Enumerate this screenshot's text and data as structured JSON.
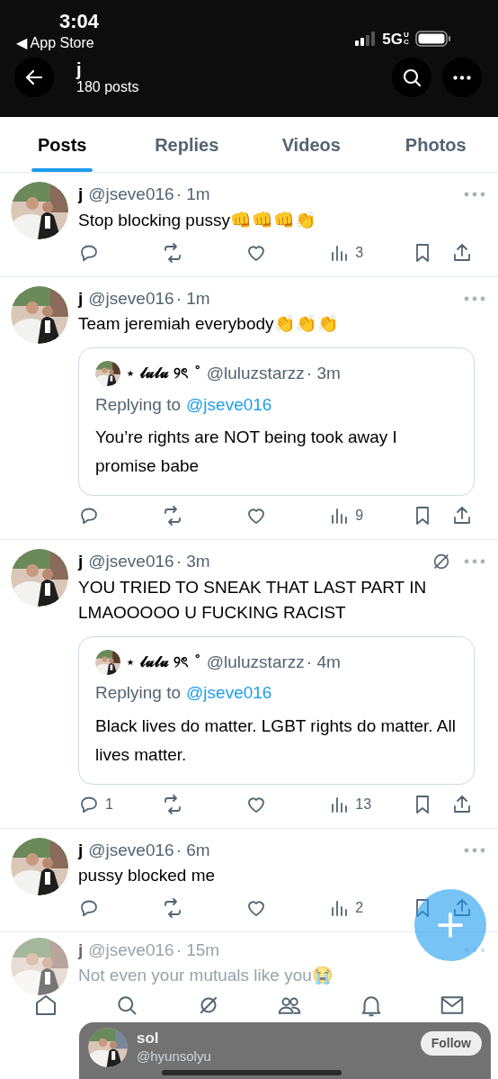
{
  "status_bar": {
    "time": "3:04",
    "back_app": "◀ App Store",
    "network": "5G",
    "network_suffix": "UC"
  },
  "header": {
    "name": "j",
    "count": "180 posts"
  },
  "tabs": [
    {
      "label": "Posts",
      "selected": true
    },
    {
      "label": "Replies",
      "selected": false
    },
    {
      "label": "Videos",
      "selected": false
    },
    {
      "label": "Photos",
      "selected": false
    }
  ],
  "posts": [
    {
      "name": "j",
      "handle": "@jseve016",
      "time": "· 1m",
      "text": "Stop blocking pussy👊👊👊👏",
      "muted_icon": false,
      "views": "3"
    },
    {
      "name": "j",
      "handle": "@jseve016",
      "time": "· 1m",
      "text": "Team jeremiah everybody👏👏👏",
      "muted_icon": false,
      "views": "9",
      "quote": {
        "name": "⋆ 𝓵𝓾𝓵𝓾 ୨ৎ ˚",
        "handle": "@luluzstarzz",
        "time": "· 3m",
        "replying_label": "Replying to",
        "replying_to": "@jseve016",
        "text": "You’re rights are NOT being took away I promise babe"
      }
    },
    {
      "name": "j",
      "handle": "@jseve016",
      "time": "· 3m",
      "text": "YOU TRIED TO SNEAK THAT LAST PART IN LMAOOOOO U FUCKING RACIST",
      "muted_icon": true,
      "replies": "1",
      "views": "13",
      "quote": {
        "name": "⋆ 𝓵𝓾𝓵𝓾 ୨ৎ ˚",
        "handle": "@luluzstarzz",
        "time": "· 4m",
        "replying_label": "Replying to",
        "replying_to": "@jseve016",
        "text": "Black lives do matter. LGBT rights do matter.  All lives matter."
      }
    },
    {
      "name": "j",
      "handle": "@jseve016",
      "time": "· 6m",
      "text": "pussy blocked me",
      "muted_icon": false,
      "views": "2"
    }
  ],
  "last_post": {
    "name": "j",
    "handle": "@jseve016",
    "time": "· 15m",
    "text": "Not even your mutuals like you😭"
  },
  "follow_card": {
    "name": "sol",
    "handle": "@hyunsolyu",
    "button": "Follow"
  }
}
